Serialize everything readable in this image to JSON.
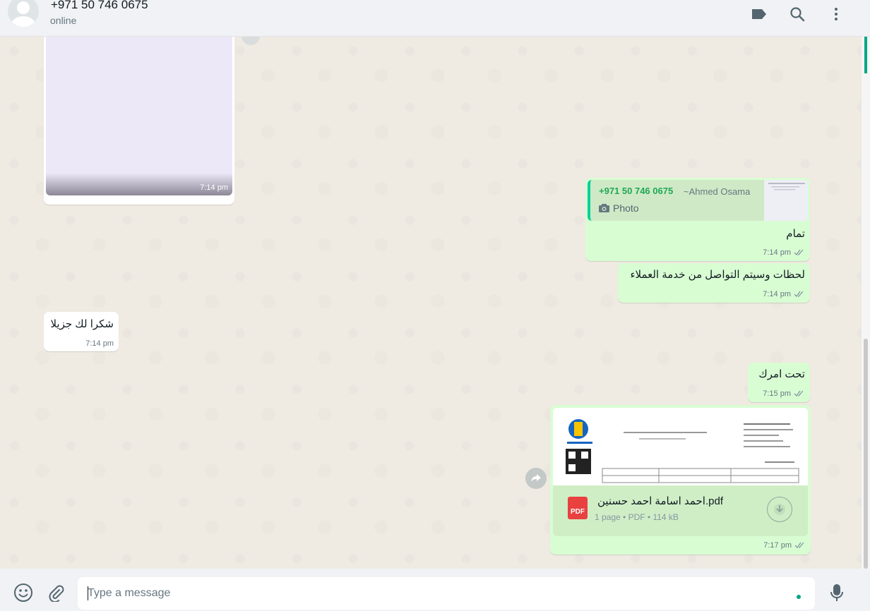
{
  "header": {
    "contact_name": "+971 50 746 0675",
    "status": "online"
  },
  "messages": {
    "image_in": {
      "time": "7:14 pm"
    },
    "reply_out": {
      "quote_name": "+971 50 746 0675",
      "quote_author": "~Ahmed Osama",
      "quote_kind": "Photo",
      "text": "تمام",
      "time": "7:14 pm"
    },
    "text_out_1": {
      "text": "لحظات وسيتم التواصل من خدمة العملاء",
      "time": "7:14 pm"
    },
    "text_in_1": {
      "text": "شكرا لك جزيلا",
      "time": "7:14 pm"
    },
    "text_out_2": {
      "text": "تحت امرك",
      "time": "7:15 pm"
    },
    "pdf_out": {
      "file_name": "احمد اسامة احمد حسنين.pdf",
      "badge": "PDF",
      "pages": "1 page",
      "type": "PDF",
      "size": "114 kB",
      "time": "7:17 pm"
    }
  },
  "composer": {
    "placeholder": "Type a message"
  },
  "colors": {
    "accent": "#00a884",
    "outgoing_bubble": "#d9fdd3",
    "incoming_bubble": "#ffffff",
    "chat_background": "#efeae2",
    "read_ticks": "#8696a0"
  },
  "icons": {
    "header": [
      "label-icon",
      "search-icon",
      "menu-icon"
    ],
    "footer": [
      "emoji-icon",
      "attach-icon",
      "mic-icon"
    ]
  }
}
